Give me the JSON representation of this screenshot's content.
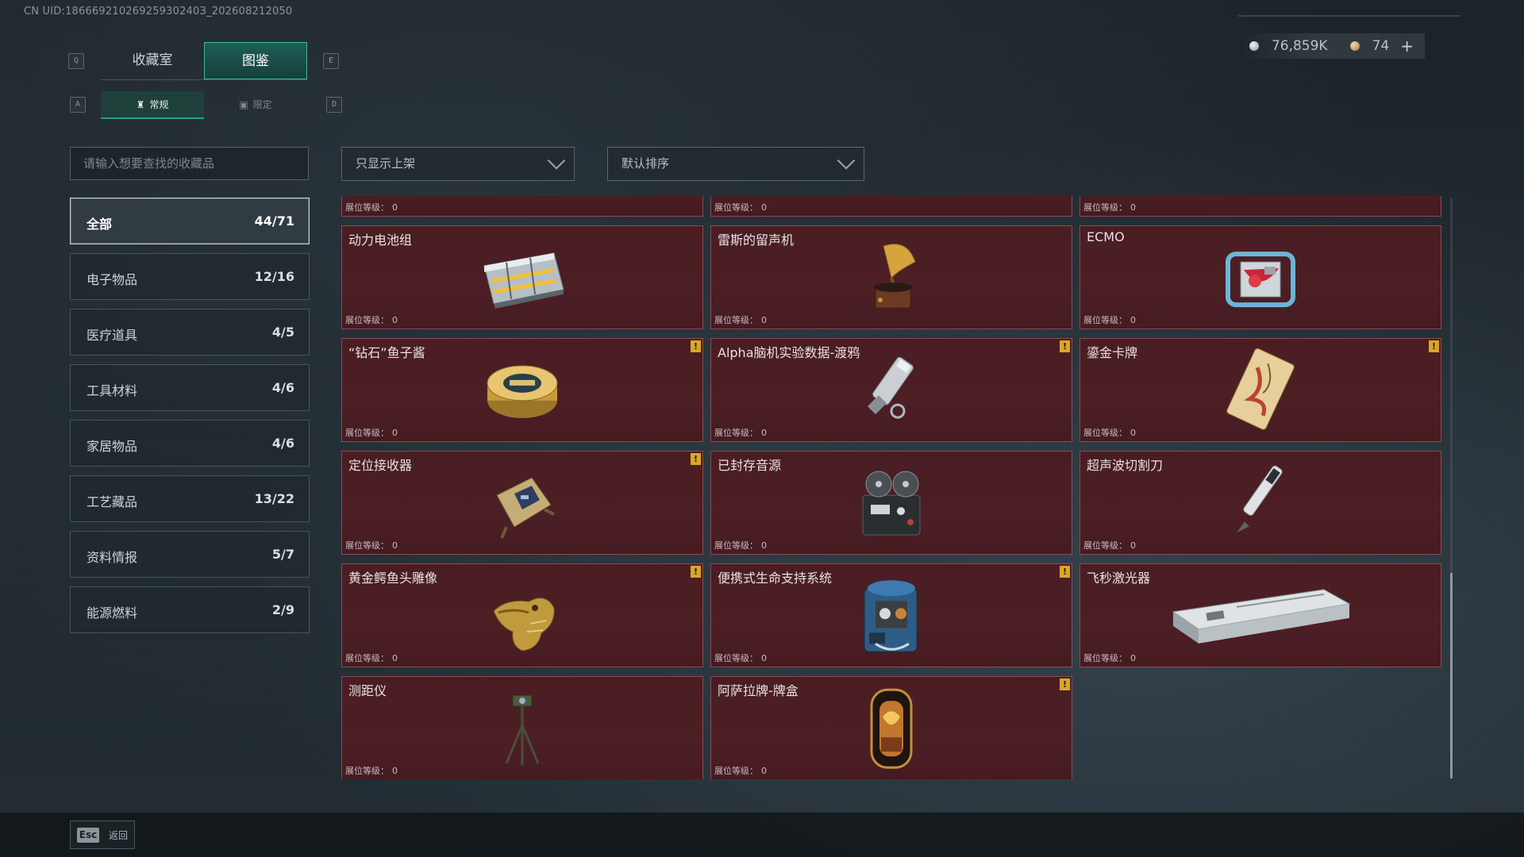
{
  "header": {
    "uid": "CN UID:18666921026925930240З_202608212050",
    "currency": {
      "silver": "76,859K",
      "gold": "74",
      "add_label": "+"
    }
  },
  "keys": {
    "prev_tab": "Q",
    "next_tab": "E",
    "prev_sub": "A",
    "next_sub": "D"
  },
  "tabs": [
    {
      "label": "收藏室"
    },
    {
      "label": "图鉴"
    }
  ],
  "subtabs": [
    {
      "label": "常规"
    },
    {
      "label": "限定"
    }
  ],
  "search": {
    "placeholder": "请输入想要查找的收藏品"
  },
  "filters": {
    "shelf": "只显示上架",
    "sort": "默认排序"
  },
  "categories": [
    {
      "name": "全部",
      "count": "44/71"
    },
    {
      "name": "电子物品",
      "count": "12/16"
    },
    {
      "name": "医疗道具",
      "count": "4/5"
    },
    {
      "name": "工具材料",
      "count": "4/6"
    },
    {
      "name": "家居物品",
      "count": "4/6"
    },
    {
      "name": "工艺藏品",
      "count": "13/22"
    },
    {
      "name": "资料情报",
      "count": "5/7"
    },
    {
      "name": "能源燃料",
      "count": "2/9"
    }
  ],
  "level_label": "展位等级：",
  "items": [
    {
      "name": "",
      "level": "0",
      "warn": false
    },
    {
      "name": "",
      "level": "0",
      "warn": false
    },
    {
      "name": "",
      "level": "0",
      "warn": false
    },
    {
      "name": "动力电池组",
      "level": "0",
      "warn": false
    },
    {
      "name": "雷斯的留声机",
      "level": "0",
      "warn": false
    },
    {
      "name": "ECMO",
      "level": "0",
      "warn": false
    },
    {
      "name": "“钻石”鱼子酱",
      "level": "0",
      "warn": true
    },
    {
      "name": "Alpha脑机实验数据-渡鸦",
      "level": "0",
      "warn": true
    },
    {
      "name": "鎏金卡牌",
      "level": "0",
      "warn": true
    },
    {
      "name": "定位接收器",
      "level": "0",
      "warn": true
    },
    {
      "name": "已封存音源",
      "level": "0",
      "warn": false
    },
    {
      "name": "超声波切割刀",
      "level": "0",
      "warn": false
    },
    {
      "name": "黄金鳄鱼头雕像",
      "level": "0",
      "warn": true
    },
    {
      "name": "便携式生命支持系统",
      "level": "0",
      "warn": true
    },
    {
      "name": "飞秒激光器",
      "level": "0",
      "warn": false
    },
    {
      "name": "测距仪",
      "level": "0",
      "warn": false
    },
    {
      "name": "阿萨拉牌-牌盒",
      "level": "0",
      "warn": true
    }
  ],
  "icons": {
    "items": [
      "partial-item-icon",
      "partial-item-icon",
      "partial-item-icon",
      "battery-pack-icon",
      "gramophone-icon",
      "ecmo-icon",
      "caviar-tin-icon",
      "data-canister-icon",
      "gilded-card-icon",
      "locator-receiver-icon",
      "reel-recorder-icon",
      "ultrasonic-knife-icon",
      "gold-crocodile-head-icon",
      "life-support-icon",
      "femtosecond-laser-icon",
      "rangefinder-tripod-icon",
      "card-box-icon"
    ]
  },
  "footer": {
    "esc_key": "Esc",
    "back_label": "返回"
  },
  "colors": {
    "accent": "#3fb59a",
    "card_bg": "#4a1d23",
    "card_border": "#8a4a52",
    "warn": "#d9a728"
  }
}
